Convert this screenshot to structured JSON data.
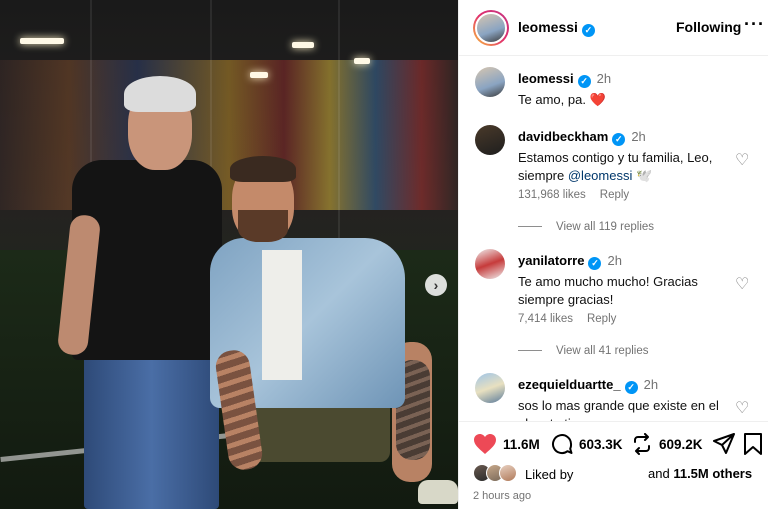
{
  "colors": {
    "accent_blue": "#0095f6",
    "like_red": "#ed4956",
    "muted": "#737373",
    "mention": "#00376b"
  },
  "post": {
    "media": {
      "next_icon": "chevron-right-icon"
    }
  },
  "header": {
    "username": "leomessi",
    "follow_label": "Following",
    "more_icon": "more-options-icon"
  },
  "caption": {
    "username": "leomessi",
    "time": "2h",
    "text": "Te amo, pa. ❤️"
  },
  "comments": [
    {
      "username": "davidbeckham",
      "time": "2h",
      "text_before": "Estamos contigo y tu familia, Leo, siempre ",
      "mention": "@leomessi",
      "text_after": " 🕊️",
      "likes": "131,968 likes",
      "reply_label": "Reply",
      "view_replies": "View all 119 replies"
    },
    {
      "username": "yanilatorre",
      "time": "2h",
      "text": "Te amo mucho mucho! Gracias siempre gracias!",
      "likes": "7,414 likes",
      "reply_label": "Reply",
      "view_replies": "View all 41 replies"
    },
    {
      "username": "ezequielduartte_",
      "time": "2h",
      "text": "sos lo mas grande que existe en el planeta tierra"
    }
  ],
  "actions": {
    "likes_count": "11.6M",
    "comments_count": "603.3K",
    "reposts_count": "609.2K",
    "like_icon": "heart-filled-icon",
    "comment_icon": "comment-icon",
    "repost_icon": "repost-icon",
    "share_icon": "send-icon",
    "save_icon": "bookmark-icon"
  },
  "liked_by": {
    "prefix": "Liked by",
    "suffix_and": "and",
    "others": "11.5M others"
  },
  "timestamp": "2 hours ago"
}
